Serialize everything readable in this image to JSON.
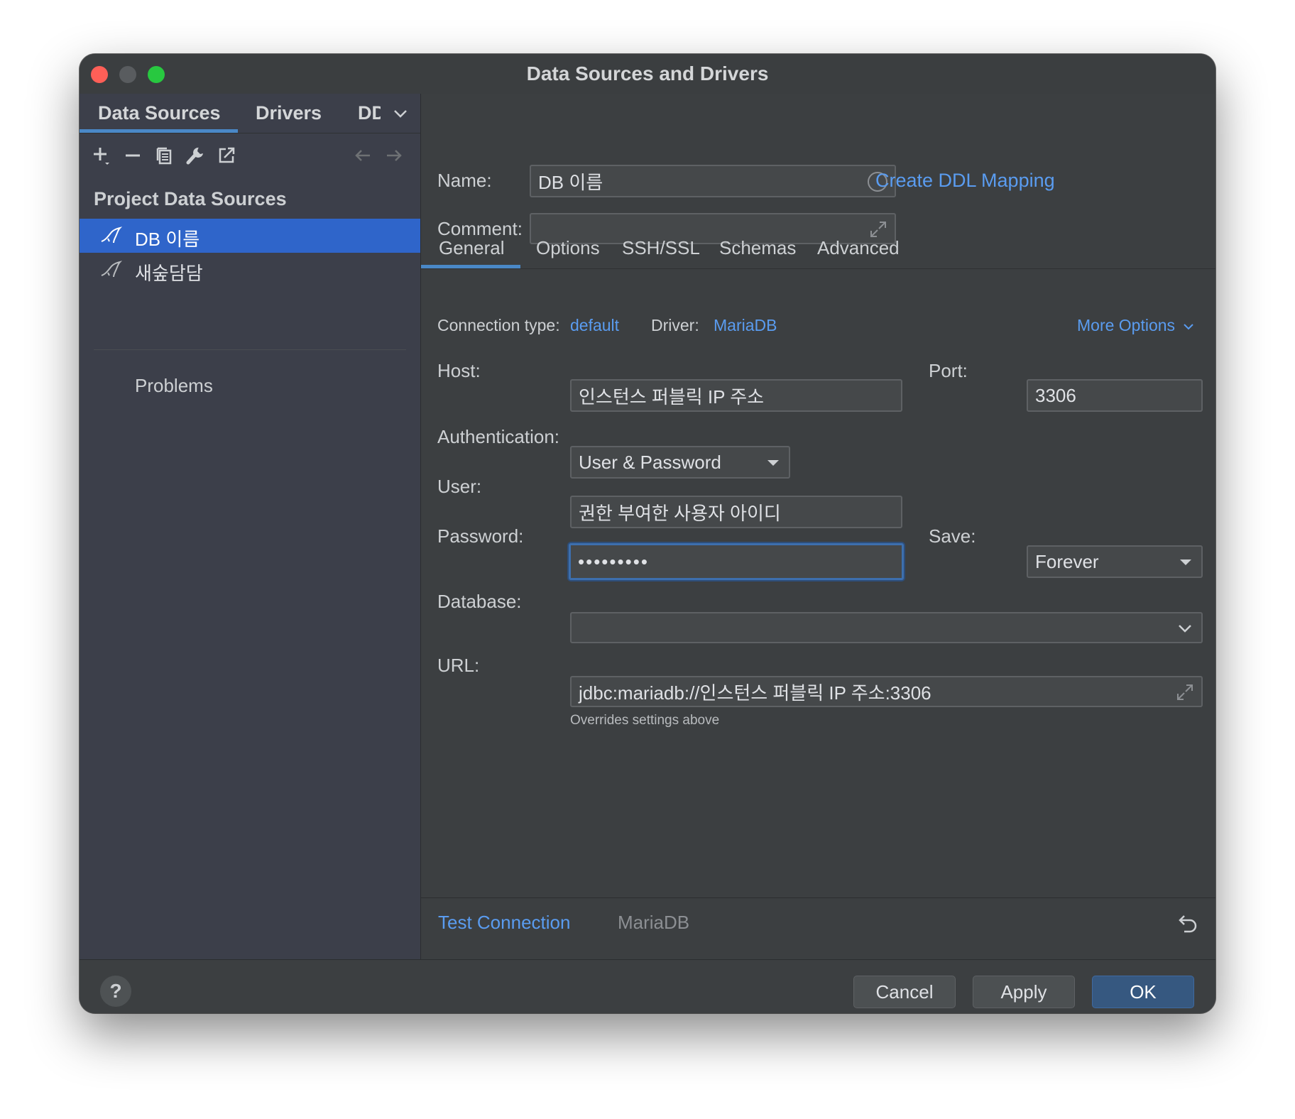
{
  "window": {
    "title": "Data Sources and Drivers"
  },
  "left_tabs": {
    "data_sources": "Data Sources",
    "drivers": "Drivers",
    "ddl": "DDL"
  },
  "sidebar": {
    "section_title": "Project Data Sources",
    "items": [
      {
        "label": "DB 이름",
        "selected": true
      },
      {
        "label": "새숲담담",
        "selected": false
      }
    ],
    "problems": "Problems"
  },
  "toolbar_icons": [
    "add-icon",
    "remove-icon",
    "duplicate-icon",
    "wrench-icon",
    "export-icon",
    "back-arrow-icon",
    "forward-arrow-icon"
  ],
  "form": {
    "name_label": "Name:",
    "name_value": "DB 이름",
    "create_ddl_link": "Create DDL Mapping",
    "comment_label": "Comment:",
    "comment_value": ""
  },
  "tabs": [
    "General",
    "Options",
    "SSH/SSL",
    "Schemas",
    "Advanced"
  ],
  "active_tab": "General",
  "connection": {
    "type_label": "Connection type:",
    "type_value": "default",
    "driver_label": "Driver:",
    "driver_value": "MariaDB",
    "more_options": "More Options"
  },
  "general": {
    "host_label": "Host:",
    "host_value": "인스턴스 퍼블릭 IP 주소",
    "port_label": "Port:",
    "port_value": "3306",
    "auth_label": "Authentication:",
    "auth_value": "User & Password",
    "user_label": "User:",
    "user_value": "권한 부여한 사용자 아이디",
    "password_label": "Password:",
    "password_value": "•••••••••",
    "save_label": "Save:",
    "save_value": "Forever",
    "database_label": "Database:",
    "database_value": "",
    "url_label": "URL:",
    "url_value": "jdbc:mariadb://인스턴스 퍼블릭 IP 주소:3306",
    "url_hint": "Overrides settings above"
  },
  "bottom": {
    "test_connection": "Test Connection",
    "driver_name": "MariaDB"
  },
  "footer": {
    "help": "?",
    "cancel": "Cancel",
    "apply": "Apply",
    "ok": "OK"
  },
  "colors": {
    "accent": "#4a88c7",
    "link": "#5a9cf0",
    "selection": "#2f65ca",
    "ok_button": "#365880"
  }
}
